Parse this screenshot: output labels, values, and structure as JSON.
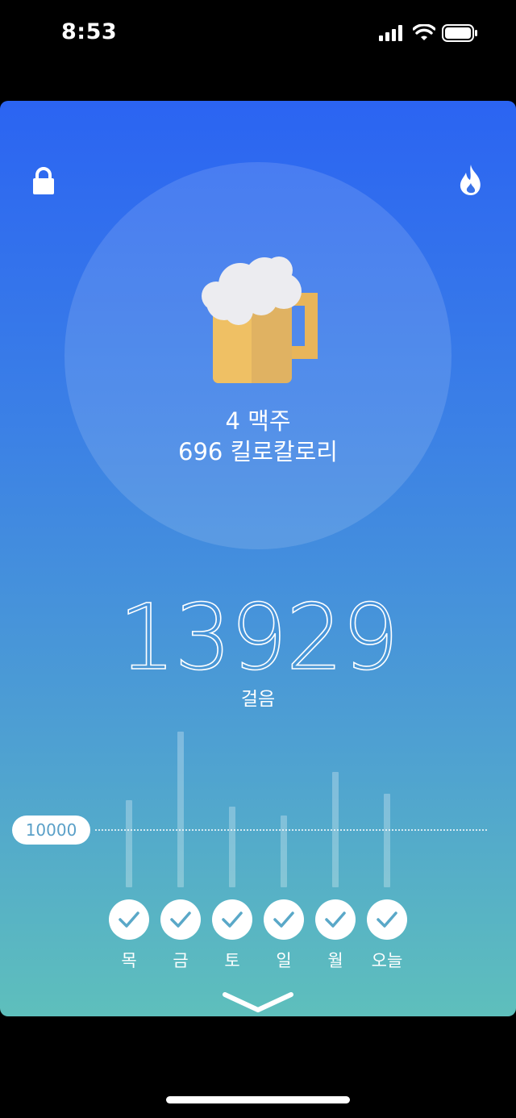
{
  "status_bar": {
    "time": "8:53"
  },
  "summary": {
    "beer_count_label": "4 맥주",
    "calories_label": "696 킬로칼로리",
    "steps": "13929",
    "steps_unit": "걸음"
  },
  "chart_data": {
    "type": "bar",
    "categories": [
      "목",
      "금",
      "토",
      "일",
      "월",
      "오늘"
    ],
    "values": [
      10800,
      13000,
      10600,
      10300,
      11700,
      11000
    ],
    "goal": 10000,
    "goal_label": "10000",
    "ylim": [
      8000,
      13000
    ],
    "completed": [
      true,
      true,
      true,
      true,
      true,
      true
    ]
  },
  "icons": {
    "lock": "lock-icon",
    "flame": "flame-icon",
    "beer": "beer-mug-icon",
    "check": "checkmark-icon",
    "chevron": "chevron-down-icon"
  },
  "colors": {
    "gradient_top": "#2b64f2",
    "gradient_bottom": "#5ebfbc",
    "check_color": "#5aa8c8"
  }
}
